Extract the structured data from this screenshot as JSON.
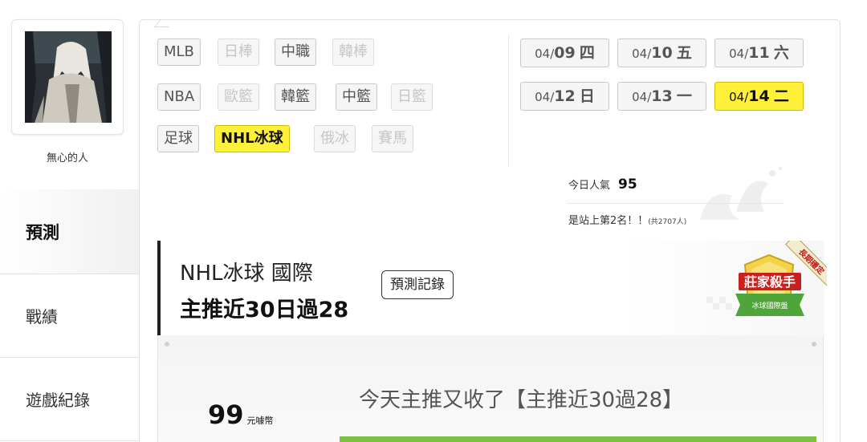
{
  "profile": {
    "username": "無心的人"
  },
  "side_nav": [
    {
      "label": "預測",
      "active": true
    },
    {
      "label": "戰績",
      "active": false
    },
    {
      "label": "遊戲紀錄",
      "active": false
    }
  ],
  "sports": [
    {
      "label": "MLB",
      "state": "normal"
    },
    {
      "label": "日棒",
      "state": "disabled"
    },
    {
      "label": "中職",
      "state": "normal"
    },
    {
      "label": "韓棒",
      "state": "disabled"
    },
    {
      "label": "NBA",
      "state": "normal"
    },
    {
      "label": "歐籃",
      "state": "disabled"
    },
    {
      "label": "韓籃",
      "state": "normal"
    },
    {
      "label": "中籃",
      "state": "normal"
    },
    {
      "label": "日籃",
      "state": "disabled"
    },
    {
      "label": "足球",
      "state": "normal"
    },
    {
      "label": "NHL冰球",
      "state": "selected"
    },
    {
      "label": "俄冰",
      "state": "disabled"
    },
    {
      "label": "賽馬",
      "state": "disabled"
    }
  ],
  "dates": [
    {
      "month": "04/",
      "day": "09",
      "weekday": "四",
      "selected": false
    },
    {
      "month": "04/",
      "day": "10",
      "weekday": "五",
      "selected": false
    },
    {
      "month": "04/",
      "day": "11",
      "weekday": "六",
      "selected": false
    },
    {
      "month": "04/",
      "day": "12",
      "weekday": "日",
      "selected": false
    },
    {
      "month": "04/",
      "day": "13",
      "weekday": "一",
      "selected": false
    },
    {
      "month": "04/",
      "day": "14",
      "weekday": "二",
      "selected": true
    }
  ],
  "stats": {
    "popularity_label": "今日人氣",
    "popularity_value": "95",
    "rank_text": "是站上第2名！！",
    "total_text": "(共2707人)"
  },
  "prediction": {
    "title": "NHL冰球 國際",
    "subtitle": "主推近30日過28",
    "record_button": "預測記錄",
    "badge_title": "莊家殺手",
    "badge_sub": "冰球國際盤",
    "badge_ribbon": "長期穩定"
  },
  "content": {
    "coins_value": "99",
    "coins_unit": "元噱幣",
    "headline": "今天主推又收了【主推近30過28】"
  },
  "colors": {
    "highlight": "#fff03a",
    "accent_green": "#7cc043"
  }
}
